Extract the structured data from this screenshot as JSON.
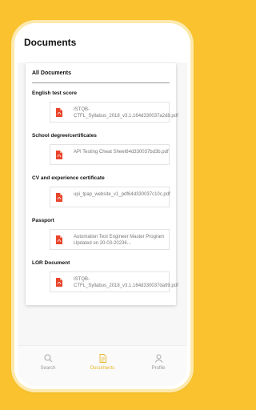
{
  "header": {
    "title": "Documents"
  },
  "section": {
    "title": "All Documents"
  },
  "groups": [
    {
      "title": "English test score",
      "file": "ISTQB-CTFL_Syllabus_2018_v3.1.164d330037a2d8.pdf"
    },
    {
      "title": "School degree/certificates",
      "file": "API Testing Cheat Sheet64d330037bd3b.pdf"
    },
    {
      "title": "CV and experience certificate",
      "file": "upi_tpap_website_v1_pdf64d330037c10c.pdf"
    },
    {
      "title": "Passport",
      "file": "Automation Test Engineer Master Program Updated on 20-03-20236..."
    },
    {
      "title": "LOR Document",
      "file": "ISTQB-CTFL_Syllabus_2018_v3.1.164d330037da99.pdf"
    }
  ],
  "nav": {
    "items": [
      {
        "label": "Search",
        "icon": "search-icon"
      },
      {
        "label": "Documents",
        "icon": "documents-icon",
        "active": true
      },
      {
        "label": "Profile",
        "icon": "profile-icon"
      }
    ]
  },
  "colors": {
    "background": "#f9c22e",
    "active": "#e7b728",
    "pdf": "#e9452b"
  }
}
